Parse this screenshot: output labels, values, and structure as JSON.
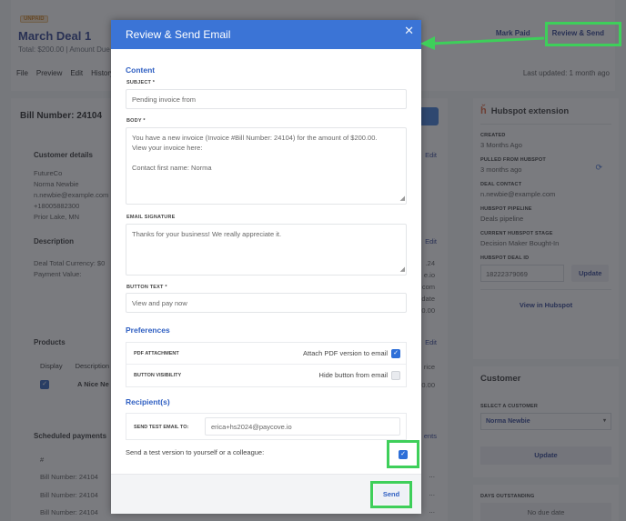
{
  "page": {
    "badge": "Unpaid",
    "deal_title": "March Deal 1",
    "deal_sub": "Total: $200.00 | Amount Due",
    "menu": [
      "File",
      "Preview",
      "Edit",
      "History"
    ],
    "actions": {
      "mark_paid": "Mark Paid",
      "review_send": "Review & Send"
    },
    "last_updated": "Last updated: 1 month ago",
    "bill_title": "Bill Number: 24104",
    "customer_details": {
      "heading": "Customer details",
      "edit": "Edit",
      "lines": [
        "FutureCo",
        "Norma Newbie",
        "n.newbie@example.com",
        "+18005882300",
        "Prior Lake, MN"
      ]
    },
    "description": {
      "heading": "Description",
      "edit": "Edit",
      "lines": [
        "Deal Total Currency: $0",
        "Payment Value:"
      ],
      "right_fragments": [
        ".24",
        "e.io",
        "com",
        "date",
        "0.00"
      ]
    },
    "products": {
      "heading": "Products",
      "edit": "Edit",
      "columns": [
        "Display",
        "Description"
      ],
      "price_header": "rice",
      "row": {
        "display": true,
        "name": "A Nice Ne",
        "price": "0.00"
      }
    },
    "scheduled": {
      "heading": "Scheduled payments",
      "link_fragment": "ents",
      "col": "#",
      "rows": [
        "Bill Number: 24104",
        "Bill Number: 24104",
        "Bill Number: 24104"
      ],
      "more": "..."
    },
    "hubspot": {
      "title": "Hubspot extension",
      "created_label": "Created",
      "created_value": "3 Months Ago",
      "pulled_label": "Pulled from Hubspot",
      "pulled_value": "3 months ago",
      "contact_label": "Deal Contact",
      "contact_value": "n.newbie@example.com",
      "pipeline_label": "Hubspot Pipeline",
      "pipeline_value": "Deals pipeline",
      "stage_label": "Current Hubspot Stage",
      "stage_value": "Decision Maker Bought-In",
      "deal_id_label": "Hubspot Deal ID",
      "deal_id_value": "18222379069",
      "update": "Update",
      "view_link": "View in Hubspot"
    },
    "customer": {
      "title": "Customer",
      "select_label": "Select a customer",
      "selected": "Norma Newbie",
      "update": "Update"
    },
    "days_outstanding": {
      "label": "Days outstanding",
      "value": "No due date"
    }
  },
  "modal": {
    "title": "Review & Send Email",
    "content_heading": "Content",
    "subject_label": "Subject *",
    "subject_value": "Pending invoice from",
    "body_label": "Body *",
    "body_value": "You have a new invoice (Invoice #Bill Number: 24104) for the amount of $200.00.\nView your invoice here:\n\nContact first name: Norma",
    "signature_label": "Email Signature",
    "signature_value": "Thanks for your business! We really appreciate it.",
    "button_text_label": "Button Text *",
    "button_text_value": "View and pay now",
    "preferences_heading": "Preferences",
    "preferences": [
      {
        "label": "PDF Attachment",
        "value": "Attach PDF version to email",
        "checked": true
      },
      {
        "label": "Button Visibility",
        "value": "Hide button from email",
        "checked": false
      }
    ],
    "recipients_heading": "Recipient(s)",
    "test_email_label": "Send test email to:",
    "test_email_value": "erica+hs2024@paycove.io",
    "test_toggle_text": "Send a test version to yourself or a colleague:",
    "test_toggle_checked": true,
    "send": "Send"
  },
  "colors": {
    "accent": "#3b74d6",
    "highlight": "#3ecf5a",
    "link": "#2a3d8f"
  }
}
